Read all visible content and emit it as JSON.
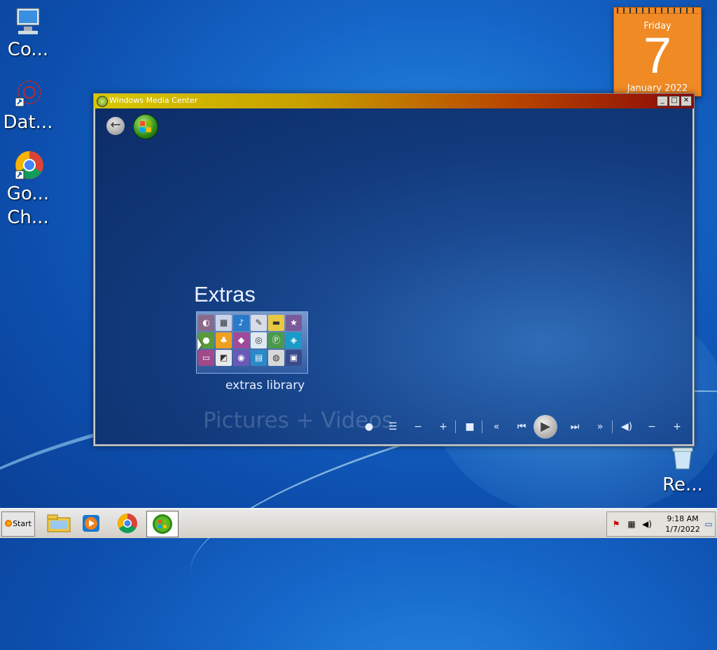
{
  "desktop": {
    "icons": [
      {
        "label": "Co...",
        "icon": "computer-icon"
      },
      {
        "label": "Dat...",
        "icon": "data-shortcut-icon"
      },
      {
        "label": "Go...",
        "label2": "Ch...",
        "icon": "google-chrome-icon"
      },
      {
        "label": "Re...",
        "icon": "recycle-bin-icon"
      }
    ]
  },
  "calendar": {
    "weekday": "Friday",
    "day": "7",
    "month_year": "January 2022"
  },
  "window": {
    "title": "Windows Media Center",
    "minimize": "_",
    "maximize": "□",
    "close": "✕"
  },
  "media_center": {
    "section_title": "Extras",
    "tile_caption": "extras library",
    "ghost_section": "Pictures + Videos",
    "transport": [
      "record-icon",
      "guide-icon",
      "channel-down-icon",
      "channel-up-icon",
      "stop-icon",
      "rewind-icon",
      "previous-icon",
      "play-icon",
      "next-icon",
      "fast-forward-icon",
      "mute-icon",
      "volume-down-icon",
      "volume-up-icon"
    ]
  },
  "taskbar": {
    "start_label": "Start",
    "items": [
      "file-explorer-icon",
      "media-player-icon",
      "chrome-icon",
      "media-center-icon"
    ],
    "clock_time": "9:18 AM",
    "clock_date": "1/7/2022"
  },
  "colors": {
    "desktop_blue": "#1566c8",
    "calendar_orange": "#f08a24",
    "wmc_background": "#123a7c"
  }
}
